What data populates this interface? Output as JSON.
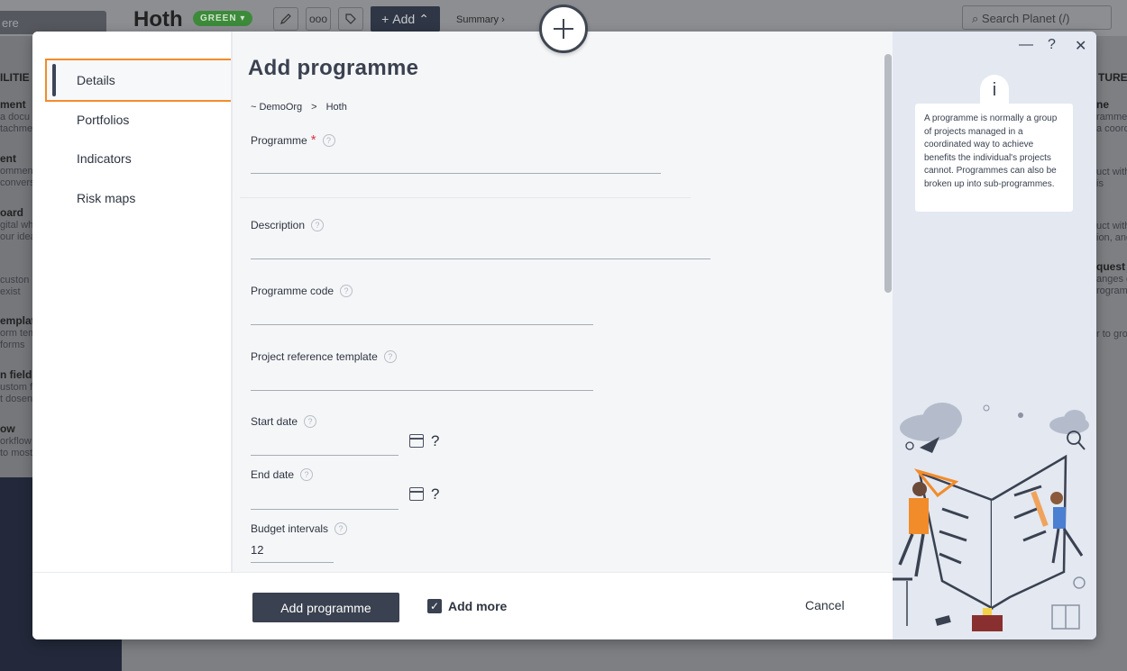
{
  "background": {
    "search_left": "ere",
    "title": "Hoth",
    "status": "GREEN",
    "tools": [
      "pencil-icon",
      "more-icon",
      "tag-icon"
    ],
    "add_label": "Add",
    "summary": "Summary",
    "search_placeholder": "Search Planet (/)",
    "left_snippets": [
      {
        "heading": "ILITIE",
        "lines": []
      },
      {
        "heading": "ment",
        "lines": [
          "a docu",
          "tachme"
        ]
      },
      {
        "heading": "ent",
        "lines": [
          "omment",
          "convers"
        ]
      },
      {
        "heading": "oard",
        "lines": [
          "gital wh",
          "our idea"
        ]
      },
      {
        "heading": "",
        "lines": [
          "custon",
          "exist"
        ]
      },
      {
        "heading": "emplat",
        "lines": [
          "orm tem",
          "forms"
        ]
      },
      {
        "heading": "n field",
        "lines": [
          "ustom fi",
          "t dosen"
        ]
      },
      {
        "heading": "ow",
        "lines": [
          "orkflow",
          "to most"
        ]
      }
    ],
    "right_snippets": [
      {
        "heading": "TURE",
        "lines": []
      },
      {
        "heading": "ne",
        "lines": [
          "ramme",
          "a coord"
        ]
      },
      {
        "heading": "",
        "lines": [
          "uct with",
          "is"
        ]
      },
      {
        "heading": "",
        "lines": [
          "uct with",
          "ion, and"
        ]
      },
      {
        "heading": "quest",
        "lines": [
          "anges c",
          "rogram"
        ]
      },
      {
        "heading": "",
        "lines": [
          "r to gro"
        ]
      }
    ]
  },
  "modal": {
    "sidebar": {
      "items": [
        {
          "label": "Details",
          "active": true
        },
        {
          "label": "Portfolios",
          "active": false
        },
        {
          "label": "Indicators",
          "active": false
        },
        {
          "label": "Risk maps",
          "active": false
        }
      ]
    },
    "title": "Add programme",
    "breadcrumb": {
      "org": "~ DemoOrg",
      "separator": ">",
      "planet": "Hoth"
    },
    "fields": {
      "programme": {
        "label": "Programme",
        "required": true,
        "value": ""
      },
      "description": {
        "label": "Description",
        "value": ""
      },
      "code": {
        "label": "Programme code",
        "value": ""
      },
      "template": {
        "label": "Project reference template",
        "value": ""
      },
      "start_date": {
        "label": "Start date",
        "value": "",
        "unknown": "?"
      },
      "end_date": {
        "label": "End date",
        "value": "",
        "unknown": "?"
      },
      "budget": {
        "label": "Budget intervals",
        "value": "12"
      }
    },
    "footer": {
      "submit_label": "Add programme",
      "add_more_label": "Add more",
      "add_more_checked": true,
      "cancel_label": "Cancel"
    },
    "window_controls": {
      "minimize": "—",
      "help": "?",
      "close": "✕"
    },
    "info": {
      "icon": "i",
      "text": "A programme is normally a group of projects managed in a coordinated way to achieve benefits the individual's projects cannot. Programmes can also be broken up into sub-programmes."
    }
  },
  "colors": {
    "accent_orange": "#f28c2b",
    "primary_dark": "#3a4150",
    "status_green": "#3d8a3a"
  }
}
